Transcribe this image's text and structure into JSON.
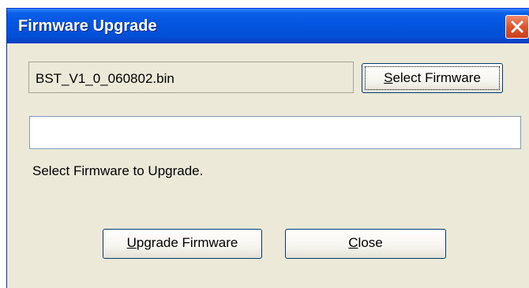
{
  "window": {
    "title": "Firmware Upgrade"
  },
  "file_path": {
    "value": "BST_V1_0_060802.bin"
  },
  "select_button": {
    "mnemonic": "S",
    "rest": "elect Firmware"
  },
  "progress": {
    "value": 0
  },
  "status_text": "Select Firmware to Upgrade.",
  "upgrade_button": {
    "mnemonic": "U",
    "rest": "pgrade Firmware"
  },
  "close_button": {
    "mnemonic": "C",
    "rest": "lose"
  },
  "icons": {
    "close": "close-icon"
  }
}
